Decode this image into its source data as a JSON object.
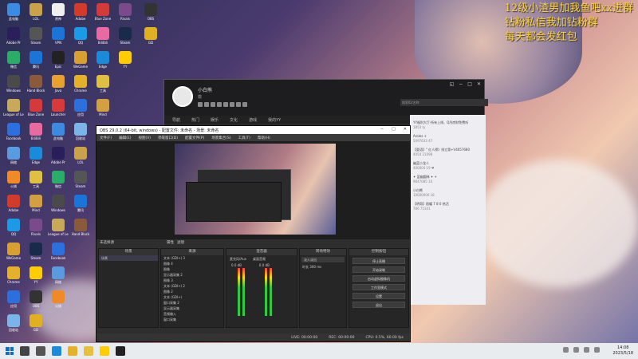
{
  "overlay_text": [
    "12级小渣男加我鱼吧xx进群",
    "钻粉私信我加钻粉群",
    "每天都会发红包"
  ],
  "desktop_icons": [
    {
      "label": "此电脑",
      "color": "#3d8be0"
    },
    {
      "label": "Adobe Pr",
      "color": "#2a1f5a"
    },
    {
      "label": "微信",
      "color": "#2aae67"
    },
    {
      "label": "Windows",
      "color": "#4a4a4a"
    },
    {
      "label": "League of Legends",
      "color": "#c8a95a"
    },
    {
      "label": "Facebook",
      "color": "#2d6fdc"
    },
    {
      "label": "网络",
      "color": "#5a9adf"
    },
    {
      "label": "火绒",
      "color": "#f08a24"
    },
    {
      "label": "Adobe",
      "color": "#d43a2a"
    },
    {
      "label": "QQ",
      "color": "#1b9ae8"
    },
    {
      "label": "WeGame",
      "color": "#d8a030"
    },
    {
      "label": "Chrome",
      "color": "#e5b02a"
    },
    {
      "label": "应用",
      "color": "#2d6fdc"
    },
    {
      "label": "回收站",
      "color": "#7ab4e8"
    },
    {
      "label": "LOL",
      "color": "#c9a34a"
    },
    {
      "label": "Steam",
      "color": "#555"
    },
    {
      "label": "腾讯",
      "color": "#1b74d8"
    },
    {
      "label": "Hand Block",
      "color": "#8a5a3a"
    },
    {
      "label": "Blue Zone",
      "color": "#d43a3a"
    },
    {
      "label": "BiliBili",
      "color": "#e86aa0"
    },
    {
      "label": "Edge",
      "color": "#1b8ad8"
    },
    {
      "label": "工具",
      "color": "#e0c040"
    },
    {
      "label": "Mind",
      "color": "#d2a040"
    },
    {
      "label": "Rivals",
      "color": "#7a4a8a"
    },
    {
      "label": "Steam",
      "color": "#1a2a4a"
    },
    {
      "label": "YY",
      "color": "#ffcc00"
    },
    {
      "label": "OBS",
      "color": "#333"
    },
    {
      "label": "GD",
      "color": "#e0b020"
    },
    {
      "label": "原神",
      "color": "#f0f0f0"
    },
    {
      "label": "VPN",
      "color": "#1b74d8"
    },
    {
      "label": "Epic",
      "color": "#222"
    },
    {
      "label": "Java",
      "color": "#e8a030"
    },
    {
      "label": "Launcher",
      "color": "#d83a3a"
    }
  ],
  "yy": {
    "name": "小白熊",
    "sub": "徽",
    "search_placeholder": "搜索ID/名称",
    "nav": [
      "导航",
      "热门",
      "娱乐",
      "文化",
      "游戏",
      "我的YY"
    ],
    "chat": [
      {
        "t": "YY福利大厅·所有上线、Q吊房财免费听",
        "m": "1853 ty"
      },
      {
        "t": "Aroles +",
        "m": "5097633  47"
      },
      {
        "t": "【夏语】\" 红人榜》排立第+V4057680",
        "m": "4054  21098"
      },
      {
        "t": "幽蓝小龙人",
        "m": "400004  19 ♥"
      },
      {
        "t": "✦ 蓝幽圆林 ✦ +",
        "m": "9847085  10"
      },
      {
        "t": "小白熊",
        "m": "10600000  18"
      },
      {
        "t": "【明哥】照耀 7 8 0 热活",
        "m": "786  75101"
      }
    ]
  },
  "obs": {
    "title": "OBS 29.0.2 (64-bit, windows) - 配置文件: 未命名 - 场景: 未命名",
    "menu": [
      "文件(F)",
      "编辑(E)",
      "视图(V)",
      "停靠窗口(D)",
      "配置文件(P)",
      "场景集合(S)",
      "工具(T)",
      "帮助(H)"
    ],
    "scene_label": "未选择源",
    "filter_buttons": [
      "属性",
      "滤镜"
    ],
    "docks": {
      "scenes": "场景",
      "sources": "来源",
      "mixer": "混音器",
      "transitions": "转场特效",
      "controls": "控制按钮"
    },
    "scene_items": [
      "场景"
    ],
    "source_items": [
      "文本 (GDI+) 3",
      "图像 4",
      "图像",
      "显示器采集 2",
      "图像 3",
      "文本 (GDI+) 2",
      "图像 2",
      "文本 (GDI+)",
      "窗口采集 2",
      "显示器采集",
      "音频输入",
      "窗口采集"
    ],
    "mixer": {
      "ch1": "桌面音频",
      "ch2": "麦克风/Aux",
      "db1": "0.0 dB",
      "db2": "0.0 dB"
    },
    "transition": {
      "select": "淡入淡出",
      "duration_label": "时长",
      "duration": "300 ms"
    },
    "controls": [
      "停止直播",
      "开始录制",
      "启动虚拟摄像机",
      "工作室模式",
      "设置",
      "退出"
    ],
    "status": {
      "live": "LIVE: 00:00:00",
      "rec": "REC: 00:00:00",
      "cpu": "CPU: 0.5%, 60.00 fps"
    }
  },
  "taskbar": {
    "apps": [
      {
        "name": "search",
        "color": "#444"
      },
      {
        "name": "taskview",
        "color": "#555"
      },
      {
        "name": "edge",
        "color": "#1b8ad8"
      },
      {
        "name": "chrome",
        "color": "#e5b02a"
      },
      {
        "name": "explorer",
        "color": "#e8c040"
      },
      {
        "name": "yy",
        "color": "#ffcc00"
      },
      {
        "name": "obs",
        "color": "#222"
      }
    ],
    "time": "14:08",
    "date": "2023/5/18"
  }
}
